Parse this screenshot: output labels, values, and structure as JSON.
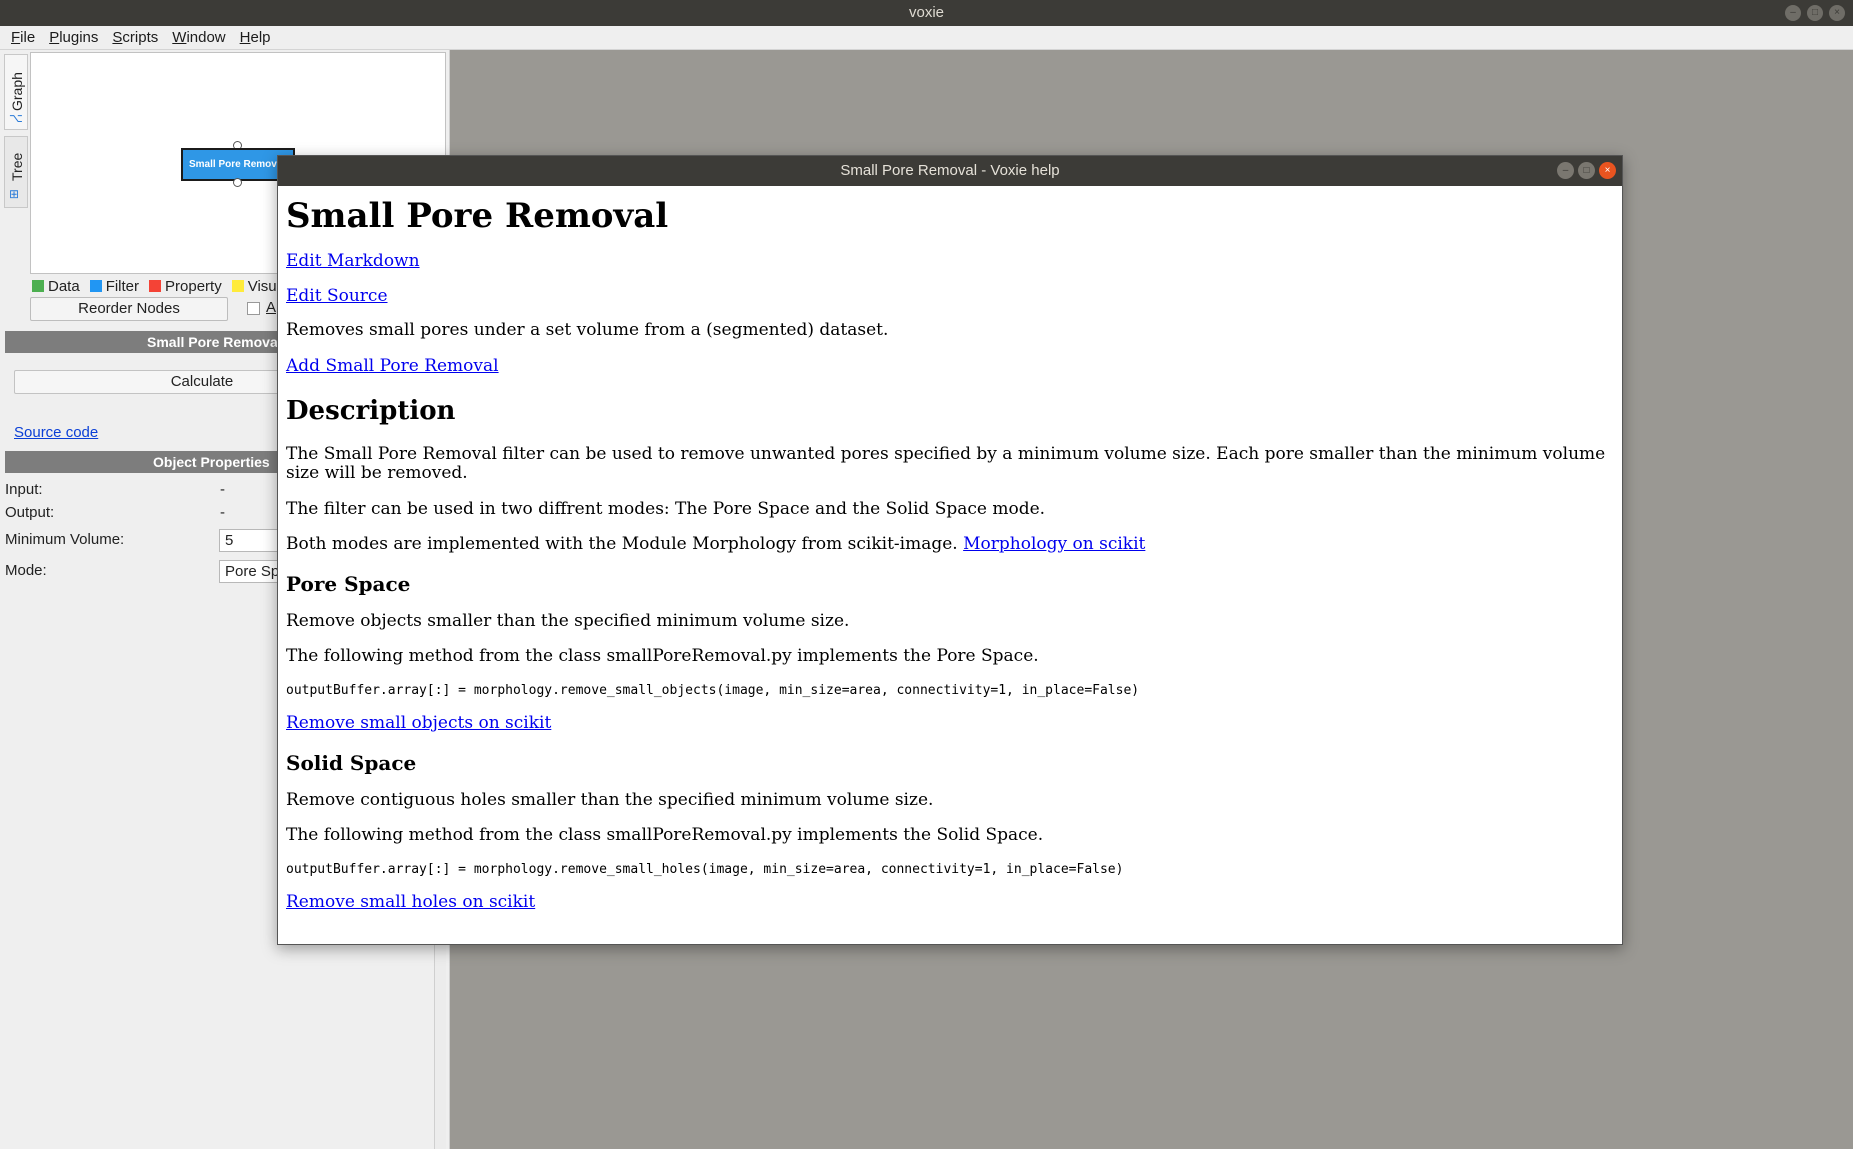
{
  "app": {
    "title": "voxie"
  },
  "menu": {
    "items": [
      {
        "pre": "",
        "ul": "F",
        "post": "ile"
      },
      {
        "pre": "",
        "ul": "P",
        "post": "lugins"
      },
      {
        "pre": "",
        "ul": "S",
        "post": "cripts"
      },
      {
        "pre": "",
        "ul": "W",
        "post": "indow"
      },
      {
        "pre": "",
        "ul": "H",
        "post": "elp"
      }
    ]
  },
  "sidebar": {
    "tabs": [
      "Graph",
      "Tree"
    ],
    "node_label": "Small Pore Removal",
    "legend": [
      {
        "label": "Data",
        "color": "#4caf50"
      },
      {
        "label": "Filter",
        "color": "#2196f3"
      },
      {
        "label": "Property",
        "color": "#f44336"
      },
      {
        "label": "Visu",
        "color": "#ffeb3b"
      }
    ],
    "reorder_button": "Reorder Nodes",
    "checkbox_label": "A",
    "section_title": "Small Pore Remova",
    "calculate_button": "Calculate",
    "source_link": "Source code",
    "object_properties_title": "Object Properties",
    "properties": {
      "input_label": "Input:",
      "input_value": "-",
      "output_label": "Output:",
      "output_value": "-",
      "min_volume_label": "Minimum Volume:",
      "min_volume_value": "5",
      "mode_label": "Mode:",
      "mode_value": "Pore Sp"
    }
  },
  "help": {
    "window_title": "Small Pore Removal - Voxie help",
    "heading": "Small Pore Removal",
    "link_edit_markdown": "Edit Markdown",
    "link_edit_source": "Edit Source",
    "summary": "Removes small pores under a set volume from a (segmented) dataset.",
    "link_add": "Add Small Pore Removal",
    "description_heading": "Description",
    "description_p1": "The Small Pore Removal filter can be used to remove unwanted pores specified by a minimum volume size. Each pore smaller than the minimum volume size will be removed.",
    "description_p2": "The filter can be used in two diffrent modes: The Pore Space and the Solid Space mode.",
    "description_p3": "Both modes are implemented with the Module Morphology from scikit-image.",
    "link_morphology": "Morphology on scikit",
    "pore_heading": "Pore Space",
    "pore_p1": "Remove objects smaller than the specified minimum volume size.",
    "pore_p2": "The following method from the class smallPoreRemoval.py implements the Pore Space.",
    "pore_code": "outputBuffer.array[:] = morphology.remove_small_objects(image, min_size=area, connectivity=1, in_place=False)",
    "link_remove_objects": "Remove small objects on scikit",
    "solid_heading": "Solid Space",
    "solid_p1": "Remove contiguous holes smaller than the specified minimum volume size.",
    "solid_p2": "The following method from the class smallPoreRemoval.py implements the Solid Space.",
    "solid_code": "outputBuffer.array[:] = morphology.remove_small_holes(image, min_size=area, connectivity=1, in_place=False)",
    "link_remove_holes": "Remove small holes on scikit"
  }
}
